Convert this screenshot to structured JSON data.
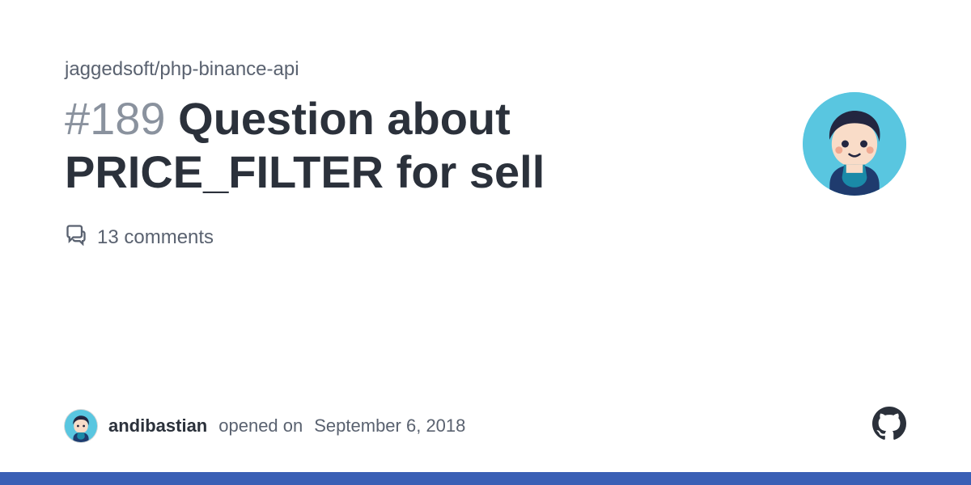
{
  "repo": "jaggedsoft/php-binance-api",
  "issue_number_display": "#189",
  "issue_title": "Question about PRICE_FILTER for sell",
  "comments_text": "13 comments",
  "author": "andibastian",
  "opened_text": "opened on",
  "date": "September 6, 2018"
}
